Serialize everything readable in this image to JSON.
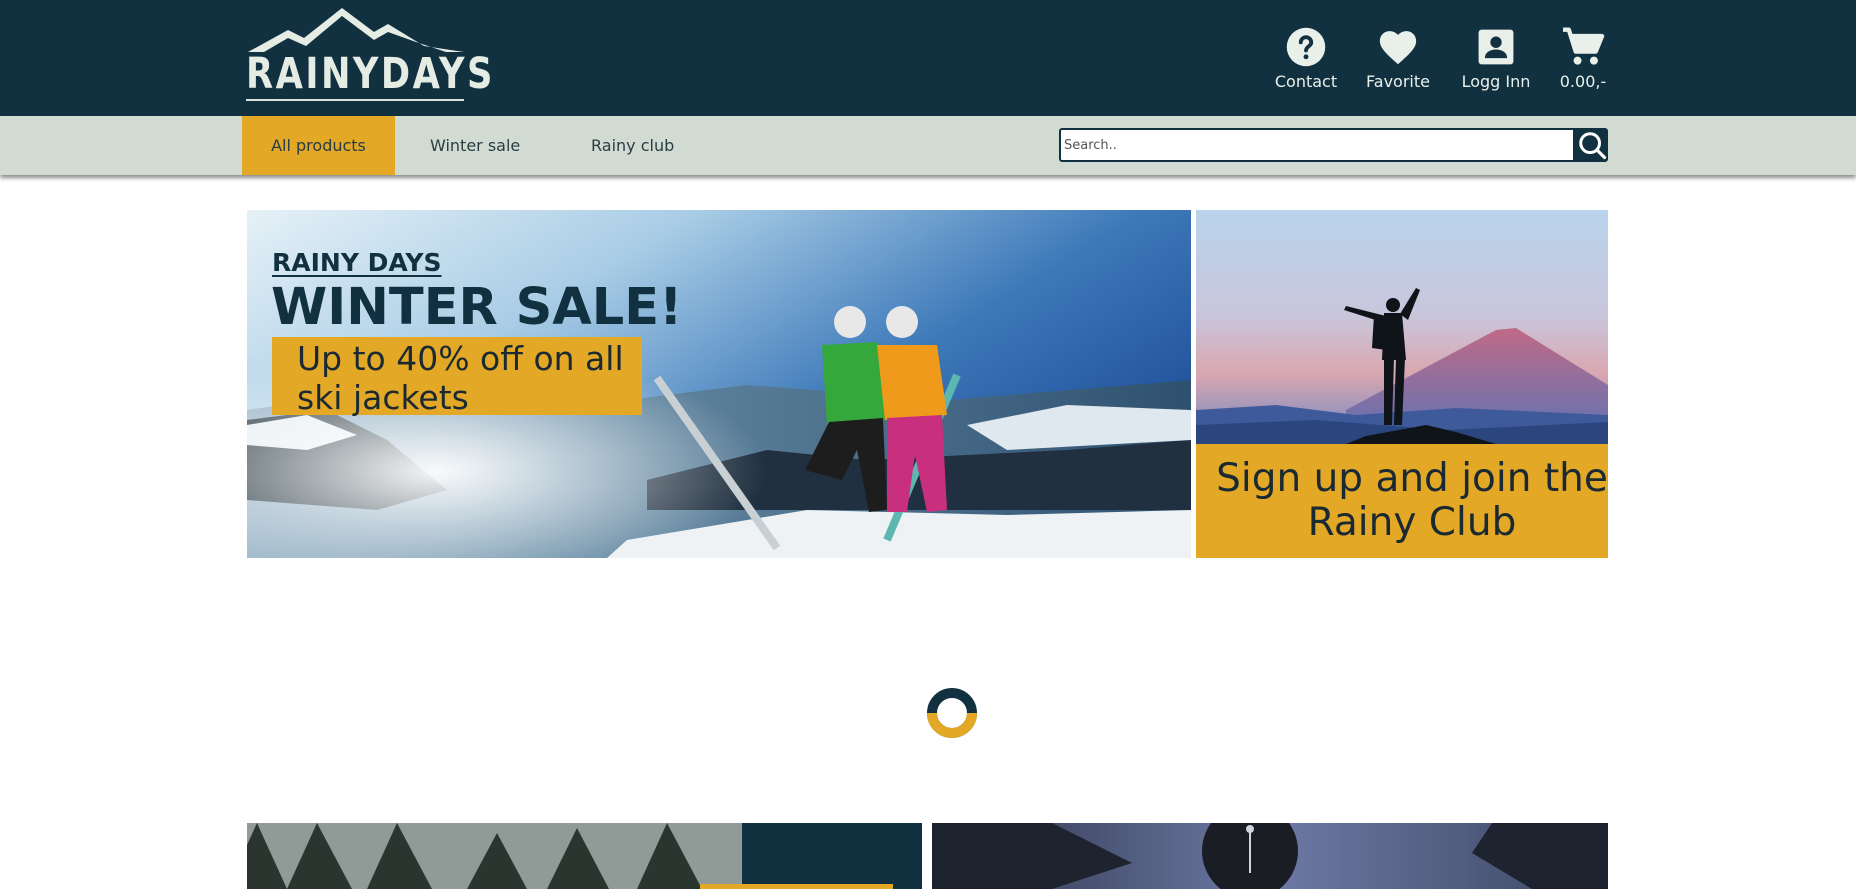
{
  "header": {
    "logo_text": "RAINYDAYS",
    "items": [
      {
        "label": "Contact",
        "icon": "help-circle-icon"
      },
      {
        "label": "Favorite",
        "icon": "heart-icon"
      },
      {
        "label": "Logg Inn",
        "icon": "account-box-icon"
      },
      {
        "label": "0.00,-",
        "icon": "cart-icon"
      }
    ]
  },
  "nav": {
    "items": [
      {
        "label": "All products",
        "active": true
      },
      {
        "label": "Winter sale",
        "active": false
      },
      {
        "label": "Rainy club",
        "active": false
      }
    ],
    "search": {
      "placeholder": "Search..",
      "value": ""
    }
  },
  "hero": {
    "sale": {
      "brand": "RAINY DAYS",
      "title": "WINTER SALE!",
      "text": "Up to 40% off on all ski jackets"
    },
    "club": {
      "text": "Sign up and join the Rainy Club"
    }
  },
  "colors": {
    "primary": "#123140",
    "accent": "#e3a826",
    "nav_bg": "#d1dbd1",
    "light_text": "#e9f0e9"
  }
}
